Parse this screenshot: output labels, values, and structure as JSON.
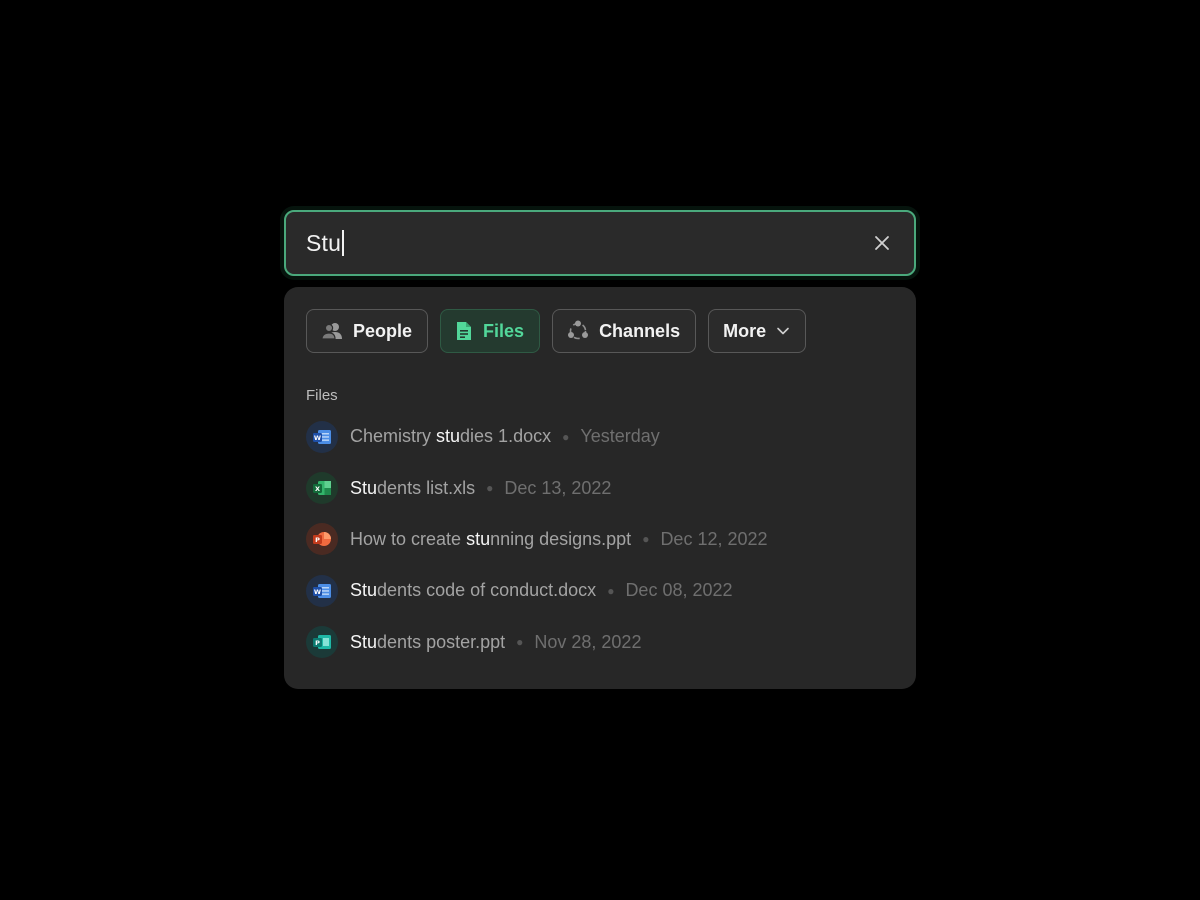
{
  "search": {
    "value": "Stu"
  },
  "filters": [
    {
      "label": "People",
      "icon": "people-icon",
      "active": false
    },
    {
      "label": "Files",
      "icon": "file-icon",
      "active": true
    },
    {
      "label": "Channels",
      "icon": "channels-icon",
      "active": false
    },
    {
      "label": "More",
      "icon": "chevron-down-icon",
      "active": false
    }
  ],
  "section_title": "Files",
  "files": [
    {
      "app": "word",
      "pre": "Chemistry ",
      "match": "stu",
      "post": "dies 1.docx",
      "date": "Yesterday"
    },
    {
      "app": "excel",
      "pre": "",
      "match": "Stu",
      "post": "dents list.xls",
      "date": "Dec 13, 2022"
    },
    {
      "app": "powerpoint",
      "pre": "How to create ",
      "match": "stu",
      "post": "nning designs.ppt",
      "date": "Dec 12, 2022"
    },
    {
      "app": "word",
      "pre": "",
      "match": "Stu",
      "post": "dents code of conduct.docx",
      "date": "Dec 08, 2022"
    },
    {
      "app": "publisher",
      "pre": "",
      "match": "Stu",
      "post": "dents poster.ppt",
      "date": "Nov 28, 2022"
    }
  ],
  "colors": {
    "accent": "#4aa97c",
    "accent_text": "#52d79a",
    "word": "#2b5fbf",
    "excel": "#1e8a4d",
    "powerpoint": "#d6502b",
    "publisher": "#0f8f84"
  }
}
